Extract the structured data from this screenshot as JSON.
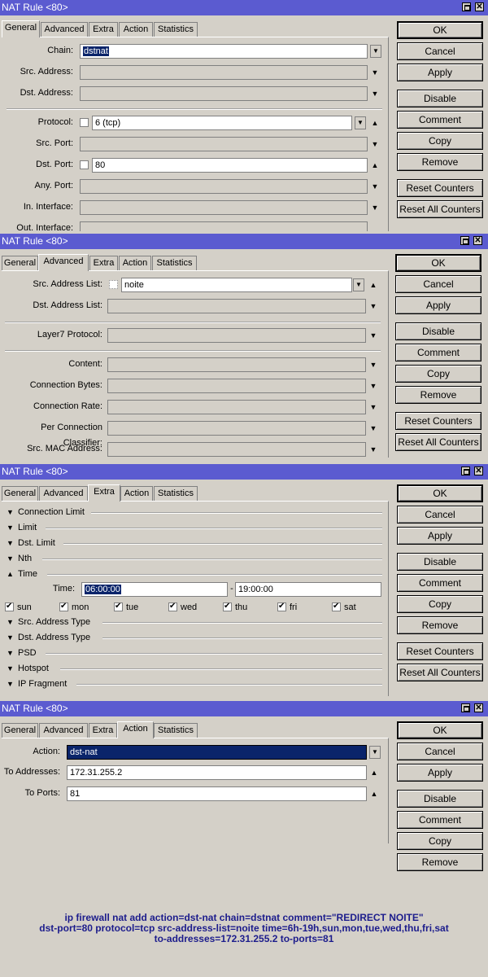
{
  "tabs": [
    "General",
    "Advanced",
    "Extra",
    "Action",
    "Statistics"
  ],
  "win1": {
    "title": "NAT Rule <80>",
    "fields": {
      "chain_label": "Chain:",
      "chain_value": "dstnat",
      "src_address_label": "Src. Address:",
      "dst_address_label": "Dst. Address:",
      "protocol_label": "Protocol:",
      "protocol_value": "6 (tcp)",
      "src_port_label": "Src. Port:",
      "dst_port_label": "Dst. Port:",
      "dst_port_value": "80",
      "any_port_label": "Any. Port:",
      "in_interface_label": "In. Interface:",
      "out_interface_label": "Out. Interface:"
    },
    "buttons": [
      "OK",
      "Cancel",
      "Apply",
      "Disable",
      "Comment",
      "Copy",
      "Remove",
      "Reset Counters",
      "Reset All Counters"
    ]
  },
  "win2": {
    "title": "NAT Rule <80>",
    "fields": {
      "src_address_list_label": "Src. Address List:",
      "src_address_list_value": "noite",
      "dst_address_list_label": "Dst. Address List:",
      "layer7_label": "Layer7 Protocol:",
      "content_label": "Content:",
      "connection_bytes_label": "Connection Bytes:",
      "connection_rate_label": "Connection Rate:",
      "pcc_label": "Per Connection Classifier:",
      "src_mac_label": "Src. MAC Address:"
    },
    "buttons": [
      "OK",
      "Cancel",
      "Apply",
      "Disable",
      "Comment",
      "Copy",
      "Remove",
      "Reset Counters",
      "Reset All Counters"
    ]
  },
  "win3": {
    "title": "NAT Rule <80>",
    "sections": {
      "connection_limit": "Connection Limit",
      "limit": "Limit",
      "dst_limit": "Dst. Limit",
      "nth": "Nth",
      "time": "Time",
      "src_address_type": "Src. Address Type",
      "dst_address_type": "Dst. Address Type",
      "psd": "PSD",
      "hotspot": "Hotspot",
      "ip_fragment": "IP Fragment"
    },
    "time_label": "Time:",
    "time_start": "06:00:00",
    "time_sep": "-",
    "time_end": "19:00:00",
    "days": [
      "sun",
      "mon",
      "tue",
      "wed",
      "thu",
      "fri",
      "sat"
    ],
    "buttons": [
      "OK",
      "Cancel",
      "Apply",
      "Disable",
      "Comment",
      "Copy",
      "Remove",
      "Reset Counters",
      "Reset All Counters"
    ]
  },
  "win4": {
    "title": "NAT Rule <80>",
    "fields": {
      "action_label": "Action:",
      "action_value": "dst-nat",
      "to_addresses_label": "To Addresses:",
      "to_addresses_value": "172.31.255.2",
      "to_ports_label": "To Ports:",
      "to_ports_value": "81"
    },
    "buttons": [
      "OK",
      "Cancel",
      "Apply",
      "Disable",
      "Comment",
      "Copy",
      "Remove"
    ]
  },
  "command": {
    "line1": "ip firewall nat add action=dst-nat chain=dstnat comment=\"REDIRECT NOITE\"",
    "line2": "dst-port=80 protocol=tcp src-address-list=noite time=6h-19h,sun,mon,tue,wed,thu,fri,sat",
    "line3": "to-addresses=172.31.255.2 to-ports=81"
  },
  "colors": {
    "titlebar": "#5b5bd0",
    "selection": "#0a246a",
    "command_text": "#1c1c8c"
  }
}
